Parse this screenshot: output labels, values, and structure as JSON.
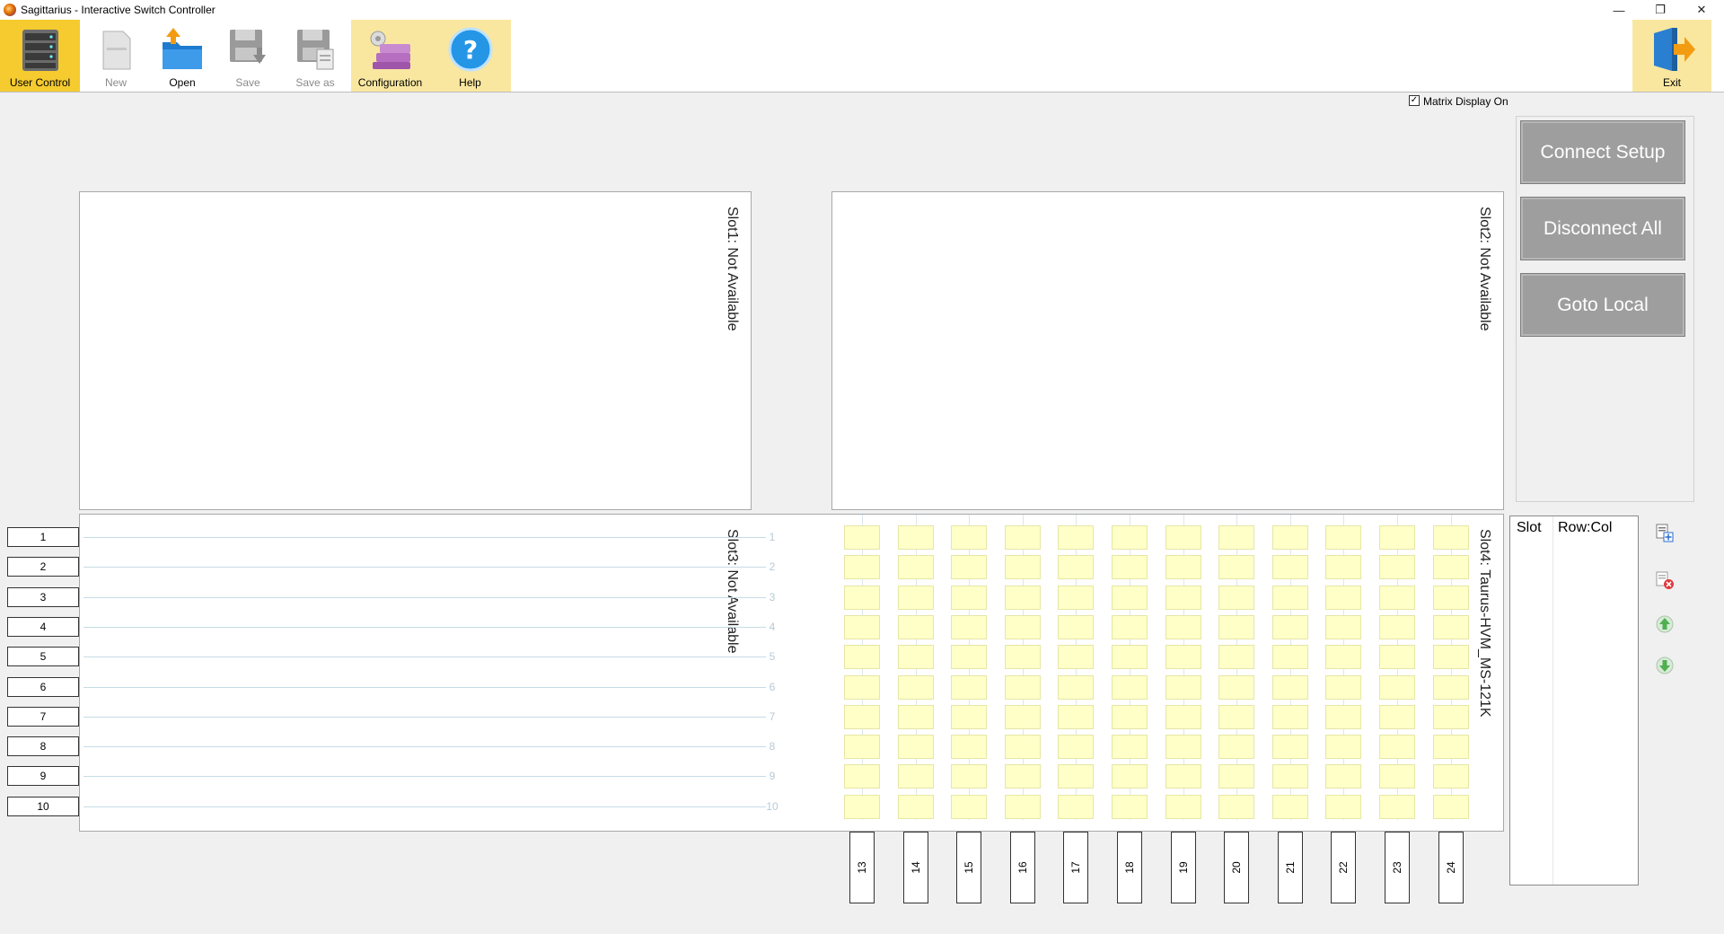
{
  "window": {
    "title": "Sagittarius - Interactive Switch Controller",
    "minimize_glyph": "—",
    "maximize_glyph": "❐",
    "close_glyph": "✕"
  },
  "toolbar": {
    "user_control": "User Control",
    "new": "New",
    "open": "Open",
    "save": "Save",
    "save_as": "Save as",
    "configuration": "Configuration",
    "help": "Help",
    "exit": "Exit"
  },
  "matrix_display": {
    "label": "Matrix Display On",
    "checked": true,
    "check_glyph": "✓"
  },
  "slots": {
    "slot1": "Slot1: Not Available",
    "slot2": "Slot2: Not Available",
    "slot3": "Slot3: Not Available",
    "slot4": "Slot4: Taurus-HVM_MS-121K"
  },
  "rows": [
    "1",
    "2",
    "3",
    "4",
    "5",
    "6",
    "7",
    "8",
    "9",
    "10"
  ],
  "columns": [
    "13",
    "14",
    "15",
    "16",
    "17",
    "18",
    "19",
    "20",
    "21",
    "22",
    "23",
    "24"
  ],
  "actions": {
    "connect_setup": "Connect Setup",
    "disconnect_all": "Disconnect All",
    "goto_local": "Goto Local"
  },
  "connection_list": {
    "col_slot": "Slot",
    "col_rowcol": "Row:Col"
  },
  "icons": {
    "add": "add-path-icon",
    "delete": "delete-path-icon",
    "up": "move-up-icon",
    "down": "move-down-icon"
  },
  "colors": {
    "active_tool": "#f5cb2f",
    "cell": "#ffffc8",
    "action_button": "#9e9e9e"
  }
}
